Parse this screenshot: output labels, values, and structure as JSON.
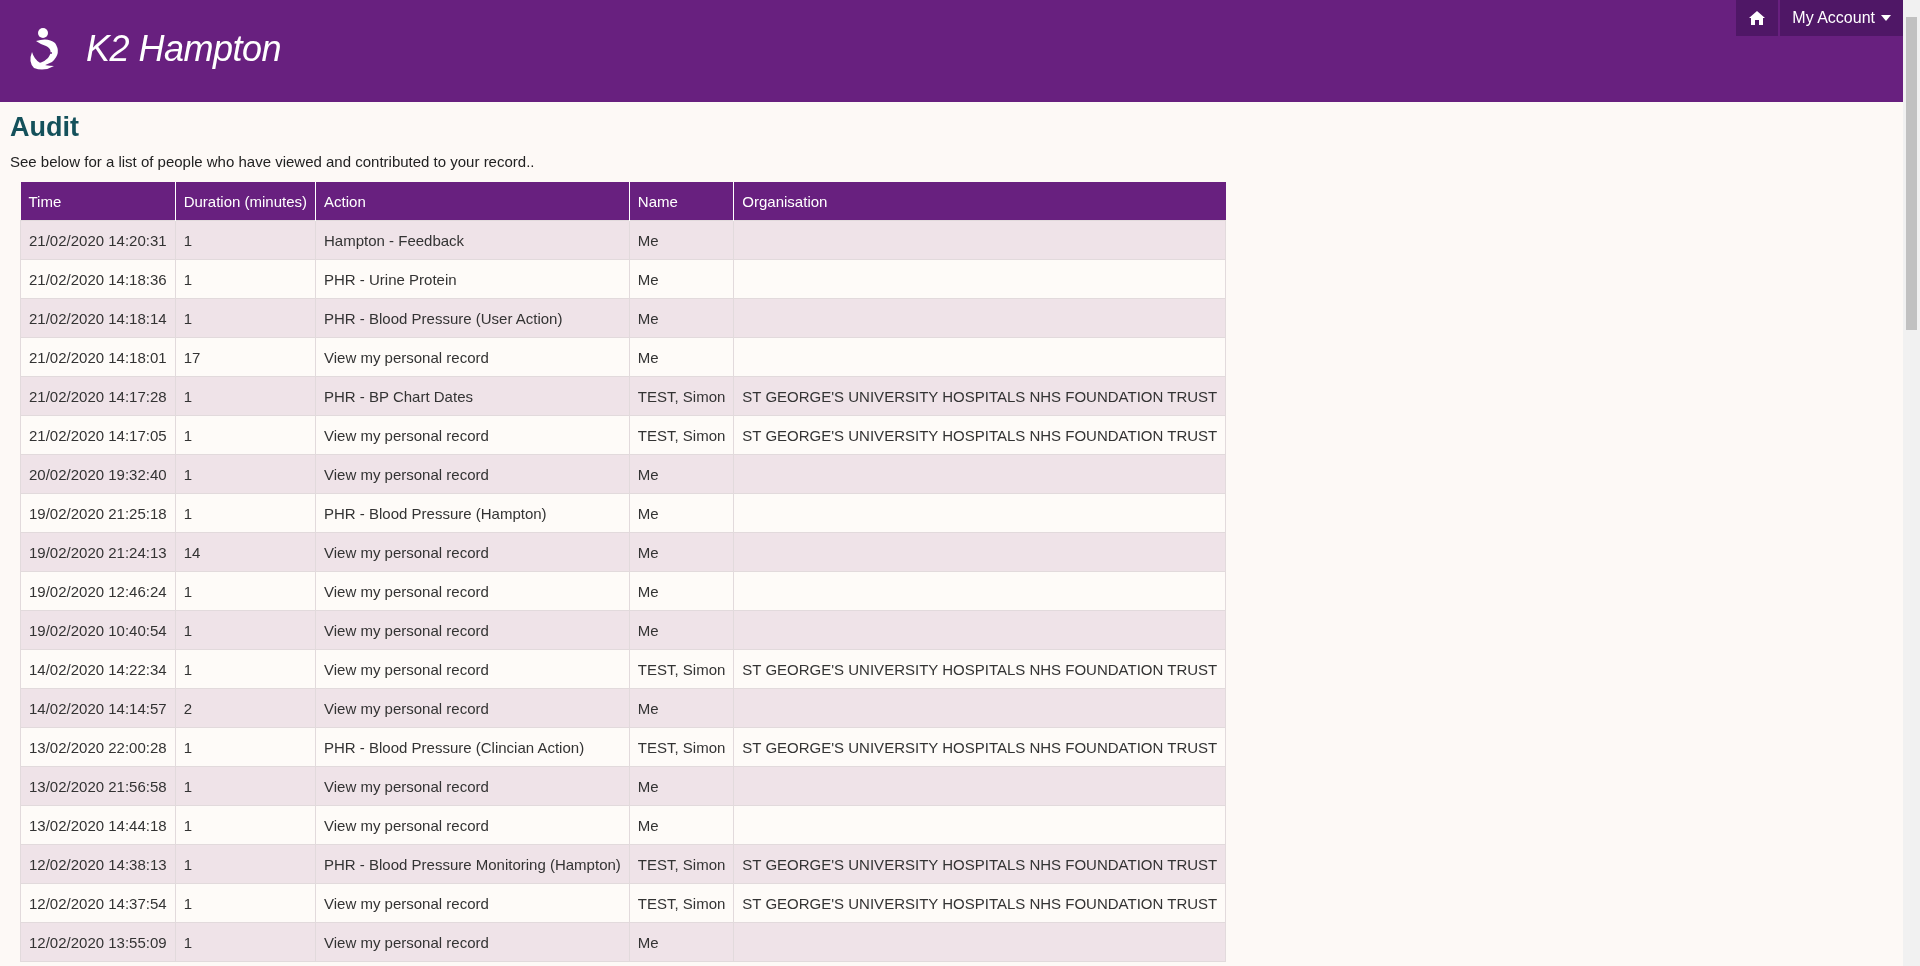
{
  "header": {
    "app_title": "K2 Hampton",
    "nav": {
      "account_menu": "My Account"
    }
  },
  "page": {
    "title": "Audit",
    "intro": "See below for a list of people who have viewed and contributed to your record.."
  },
  "table": {
    "columns": [
      "Time",
      "Duration (minutes)",
      "Action",
      "Name",
      "Organisation"
    ],
    "rows": [
      [
        "21/02/2020 14:20:31",
        "1",
        "Hampton - Feedback",
        "Me",
        ""
      ],
      [
        "21/02/2020 14:18:36",
        "1",
        "PHR - Urine Protein",
        "Me",
        ""
      ],
      [
        "21/02/2020 14:18:14",
        "1",
        "PHR - Blood Pressure (User Action)",
        "Me",
        ""
      ],
      [
        "21/02/2020 14:18:01",
        "17",
        "View my personal record",
        "Me",
        ""
      ],
      [
        "21/02/2020 14:17:28",
        "1",
        "PHR - BP Chart Dates",
        "TEST, Simon",
        "ST GEORGE'S UNIVERSITY HOSPITALS NHS FOUNDATION TRUST"
      ],
      [
        "21/02/2020 14:17:05",
        "1",
        "View my personal record",
        "TEST, Simon",
        "ST GEORGE'S UNIVERSITY HOSPITALS NHS FOUNDATION TRUST"
      ],
      [
        "20/02/2020 19:32:40",
        "1",
        "View my personal record",
        "Me",
        ""
      ],
      [
        "19/02/2020 21:25:18",
        "1",
        "PHR - Blood Pressure (Hampton)",
        "Me",
        ""
      ],
      [
        "19/02/2020 21:24:13",
        "14",
        "View my personal record",
        "Me",
        ""
      ],
      [
        "19/02/2020 12:46:24",
        "1",
        "View my personal record",
        "Me",
        ""
      ],
      [
        "19/02/2020 10:40:54",
        "1",
        "View my personal record",
        "Me",
        ""
      ],
      [
        "14/02/2020 14:22:34",
        "1",
        "View my personal record",
        "TEST, Simon",
        "ST GEORGE'S UNIVERSITY HOSPITALS NHS FOUNDATION TRUST"
      ],
      [
        "14/02/2020 14:14:57",
        "2",
        "View my personal record",
        "Me",
        ""
      ],
      [
        "13/02/2020 22:00:28",
        "1",
        "PHR - Blood Pressure (Clincian Action)",
        "TEST, Simon",
        "ST GEORGE'S UNIVERSITY HOSPITALS NHS FOUNDATION TRUST"
      ],
      [
        "13/02/2020 21:56:58",
        "1",
        "View my personal record",
        "Me",
        ""
      ],
      [
        "13/02/2020 14:44:18",
        "1",
        "View my personal record",
        "Me",
        ""
      ],
      [
        "12/02/2020 14:38:13",
        "1",
        "PHR - Blood Pressure Monitoring (Hampton)",
        "TEST, Simon",
        "ST GEORGE'S UNIVERSITY HOSPITALS NHS FOUNDATION TRUST"
      ],
      [
        "12/02/2020 14:37:54",
        "1",
        "View my personal record",
        "TEST, Simon",
        "ST GEORGE'S UNIVERSITY HOSPITALS NHS FOUNDATION TRUST"
      ],
      [
        "12/02/2020 13:55:09",
        "1",
        "View my personal record",
        "Me",
        ""
      ]
    ]
  }
}
